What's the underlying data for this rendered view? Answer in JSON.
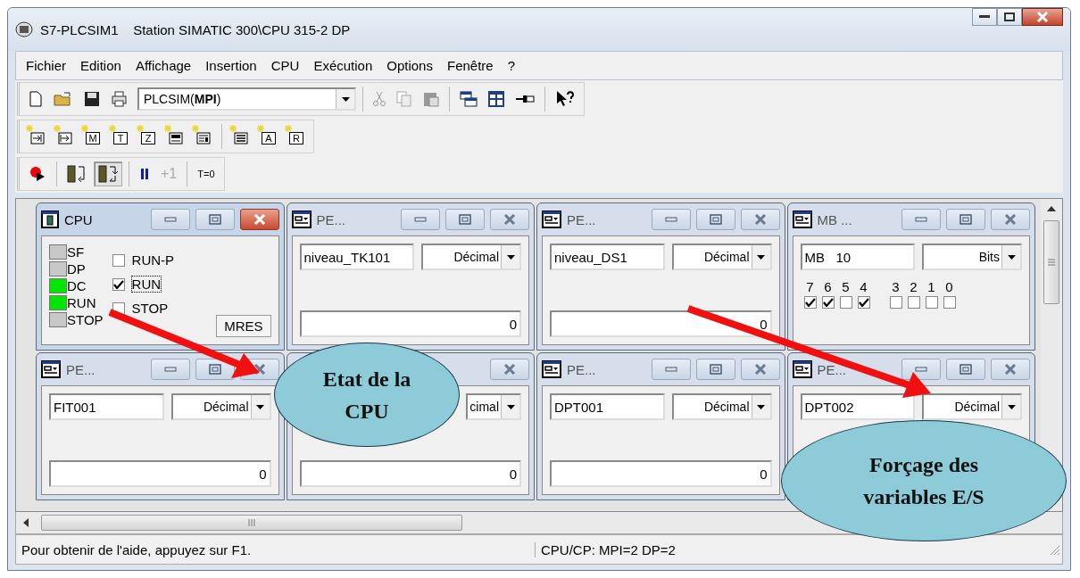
{
  "window": {
    "title": "S7-PLCSIM1    Station SIMATIC 300\\CPU 315-2 DP"
  },
  "menu": [
    "Fichier",
    "Edition",
    "Affichage",
    "Insertion",
    "CPU",
    "Exécution",
    "Options",
    "Fenêtre",
    "?"
  ],
  "toolbar": {
    "network": "PLCSIM(**MPI**)"
  },
  "insert_buttons": [
    {
      "kind": "input"
    },
    {
      "kind": "output"
    },
    {
      "kind": "letter",
      "letter": "M"
    },
    {
      "kind": "letter",
      "letter": "T"
    },
    {
      "kind": "letter",
      "letter": "Z"
    },
    {
      "kind": "block"
    },
    {
      "kind": "stack"
    },
    {
      "kind": "list"
    },
    {
      "kind": "letter",
      "letter": "A"
    },
    {
      "kind": "letter",
      "letter": "R"
    }
  ],
  "run_toolbar": {
    "scan_modes": [
      {
        "selected": false
      },
      {
        "selected": true
      }
    ],
    "step": "+1",
    "step_disabled": true,
    "reset_timers": "T=0"
  },
  "windows": [
    {
      "kind": "cpu",
      "title": "CPU",
      "active": true,
      "leds": [
        {
          "label": "SF",
          "on": false
        },
        {
          "label": "DP",
          "on": false
        },
        {
          "label": "DC",
          "on": true
        },
        {
          "label": "RUN",
          "on": true
        },
        {
          "label": "STOP",
          "on": false
        }
      ],
      "modes": [
        {
          "label": "RUN-P",
          "checked": false
        },
        {
          "label": "RUN",
          "checked": true
        },
        {
          "label": "STOP",
          "checked": false
        }
      ],
      "reset": "MRES"
    },
    {
      "kind": "variable",
      "title": "PE...",
      "active": false,
      "address": "niveau_TK101",
      "format": "Décimal",
      "value": "0"
    },
    {
      "kind": "variable",
      "title": "PE...",
      "active": false,
      "address": "niveau_DS1",
      "format": "Décimal",
      "value": "0"
    },
    {
      "kind": "bits",
      "title": "MB ...",
      "active": false,
      "address": "MB   10",
      "format": "Bits",
      "bits": [
        {
          "label": "7",
          "checked": true
        },
        {
          "label": "6",
          "checked": true
        },
        {
          "label": "5",
          "checked": false
        },
        {
          "label": "4",
          "checked": true
        },
        {
          "label": "3",
          "checked": false
        },
        {
          "label": "2",
          "checked": false
        },
        {
          "label": "1",
          "checked": false
        },
        {
          "label": "0",
          "checked": false
        }
      ]
    },
    {
      "kind": "variable",
      "title": "PE...",
      "active": false,
      "address": "FIT001",
      "format": "Décimal",
      "value": "0"
    },
    {
      "kind": "variable",
      "active": false,
      "format": "cimal",
      "value": "0"
    },
    {
      "kind": "variable",
      "title": "PE...",
      "active": false,
      "address": "DPT001",
      "format": "Décimal",
      "value": "0"
    },
    {
      "kind": "variable",
      "title": "PE...",
      "active": false,
      "address": "DPT002",
      "format": "Décimal"
    }
  ],
  "status_bar": [
    "Pour obtenir de l'aide, appuyez sur F1.",
    "CPU/CP:  MPI=2 DP=2"
  ],
  "callouts": [
    "Etat de la CPU",
    "Forçage des variables E/S"
  ]
}
